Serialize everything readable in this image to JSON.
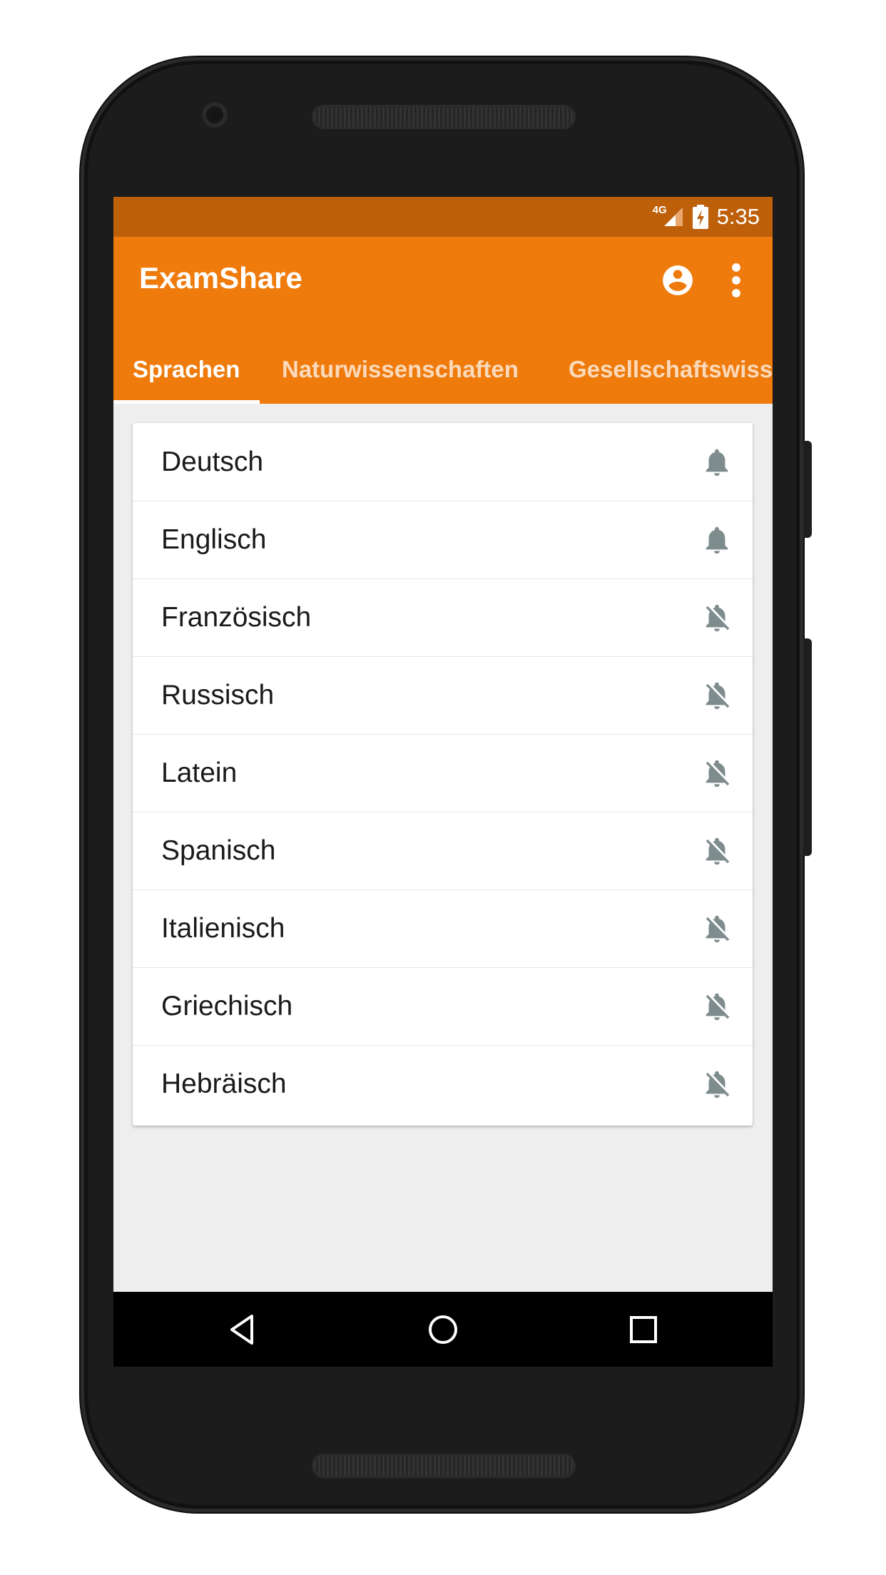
{
  "colors": {
    "primary": "#ef7b0c",
    "primary_dark": "#be5f0a",
    "icon_grey": "#7f8c8d"
  },
  "status_bar": {
    "network": "4G",
    "time": "5:35"
  },
  "app_bar": {
    "title": "ExamShare",
    "account_icon": "account-circle-icon",
    "menu_icon": "more-vert-icon"
  },
  "tabs": [
    {
      "label": "Sprachen",
      "active": true
    },
    {
      "label": "Naturwissenschaften",
      "active": false
    },
    {
      "label": "Gesellschaftswiss",
      "active": false
    }
  ],
  "subjects": [
    {
      "name": "Deutsch",
      "notifications": "on",
      "icon": "bell-icon"
    },
    {
      "name": "Englisch",
      "notifications": "on",
      "icon": "bell-icon"
    },
    {
      "name": "Französisch",
      "notifications": "off",
      "icon": "bell-off-icon"
    },
    {
      "name": "Russisch",
      "notifications": "off",
      "icon": "bell-off-icon"
    },
    {
      "name": "Latein",
      "notifications": "off",
      "icon": "bell-off-icon"
    },
    {
      "name": "Spanisch",
      "notifications": "off",
      "icon": "bell-off-icon"
    },
    {
      "name": "Italienisch",
      "notifications": "off",
      "icon": "bell-off-icon"
    },
    {
      "name": "Griechisch",
      "notifications": "off",
      "icon": "bell-off-icon"
    },
    {
      "name": "Hebräisch",
      "notifications": "off",
      "icon": "bell-off-icon"
    }
  ],
  "nav_bar": {
    "back_icon": "back-triangle-icon",
    "home_icon": "home-circle-icon",
    "recents_icon": "recents-square-icon"
  }
}
